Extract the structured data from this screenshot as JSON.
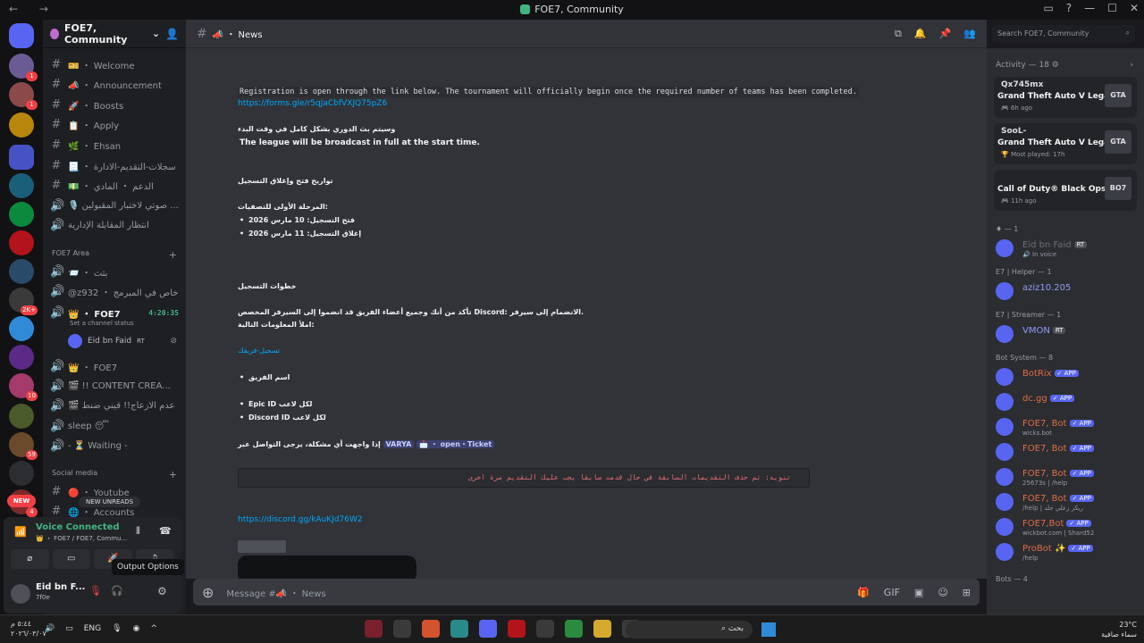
{
  "window": {
    "title": "FOE7, Community",
    "nav": "← →",
    "controls": [
      "▭",
      "?",
      "—",
      "☐",
      "✕"
    ]
  },
  "server": {
    "name": "FOE7, Community"
  },
  "channels": [
    {
      "hash": "#",
      "label": "🎫 ・ Welcome",
      "active": false
    },
    {
      "hash": "#",
      "label": "📣 ・ Announcement",
      "active": false
    },
    {
      "hash": "#",
      "label": "🚀 ・ Boosts",
      "active": false
    },
    {
      "hash": "#",
      "label": "📋 ・ Apply",
      "active": false
    },
    {
      "hash": "#",
      "label": "🌿 ・ Ehsan",
      "active": false
    },
    {
      "hash": "#",
      "label": "📃 ・ سجلات-التقديم-الادارة",
      "active": false
    },
    {
      "hash": "#",
      "label": "💵 ・ الدعم ・ المادي",
      "active": false
    },
    {
      "hash": "🔊",
      "label": "🎙️ صوتي لاختبار المقبولين ...",
      "active": false
    },
    {
      "hash": "🔊",
      "label": "انتظار المقابلة الإدارية",
      "active": false
    }
  ],
  "category_area": {
    "label": "FOE7 Area",
    "plus": "+"
  },
  "area_channels": [
    {
      "hash": "🔊",
      "label": "📨 ・ بثث"
    },
    {
      "hash": "🔊",
      "label": "@z932 ・ خاص في المبرمج"
    },
    {
      "hash": "🔊",
      "label": "👑 ・ FOE7",
      "time": "4:20:35",
      "active": true
    },
    {
      "hash": "🔊",
      "label": "👑 ・ FOE7"
    },
    {
      "hash": "🔊",
      "label": "🎬 !! CONTENT CREA..."
    },
    {
      "hash": "🔊",
      "label": "🎬 عدم الازعاج!! قيني ضنط"
    },
    {
      "hash": "🔊",
      "label": "sleep 😴"
    },
    {
      "hash": "🔊",
      "label": "- ⏳ Waiting -"
    }
  ],
  "channel_status_hint": "Set a channel status",
  "voice_user": "Eid bn Faid",
  "voice_user_tag": "RT",
  "category_social": {
    "label": "Social media",
    "plus": "+"
  },
  "social_channels": [
    {
      "hash": "#",
      "label": "🔴 ・ Youtube"
    },
    {
      "hash": "#",
      "label": "🌐 ・ Accounts"
    }
  ],
  "new_unreads": "NEW UNREADS",
  "voice_panel": {
    "status": "Voice Connected",
    "sub": "👑 ・ FOE7 / FOE7, Commu...",
    "buttons": [
      "⌀",
      "▭",
      "🚀",
      "♫"
    ],
    "user_name": "Eid bn F...",
    "user_tag": "7f0e",
    "tooltip": "Output Options"
  },
  "chat": {
    "channel_name": "📣 ・ News",
    "composer_placeholder": "Message #📣 ・ News",
    "lines": {
      "registration": "Registration is open through the link below. The tournament will officially begin once the required number of teams has been completed.",
      "form_link": "https://forms.gle/r5qJaCbfVXJQ75pZ6",
      "ar_broadcast": "وسيتم بث الدوري بشكل كامل في وقت البدء",
      "en_broadcast": "The league will be broadcast in full at the start time.",
      "ar_dates_title": "تواريخ فتح وإغلاق التسجيل",
      "ar_phase": "المرحلة الأولى للتصفيات:",
      "ar_open": "فتح التسجيل: 10 مارس 2026",
      "ar_close": "إغلاق التسجيل: 11 مارس 2026",
      "ar_steps": "خطوات التسجيل",
      "ar_step1": "تأكد من أنك وجميع أعضاء الفريق قد انضموا إلى السيرفر المخصص Discord: الانضمام إلى سيرفر.",
      "ar_step2": "املأ المعلومات التالية:",
      "ar_team_link": "تسجيل-فريقك",
      "ar_team_name": "اسم الفريق",
      "ar_epic": "Epic ID لكل لاعب",
      "ar_discord": "Discord ID لكل لاعب",
      "ar_contact": "إذا واجهت أي مشكلة، يرجى التواصل عبر",
      "mention1": "VARYA",
      "mention2": "📩 ・ open・Ticket",
      "code_note": "تنويه: تم حذف التقديمات السابقة في حال قدمت سابقا يجب عليك التقديم مرة اخرى",
      "discord_link": "https://discord.gg/kAuKJd76W2"
    }
  },
  "header_icons": [
    "⧉",
    "🔔",
    "📌",
    "👥"
  ],
  "search_placeholder": "Search FOE7, Community",
  "composer_icons": [
    "🎁",
    "GIF",
    "▣",
    "☺",
    "⊞"
  ],
  "members": {
    "activity_header": "Activity — 18 ⚙",
    "activities": [
      {
        "user": "Qx745mx",
        "game": "Grand Theft Auto V Legacy",
        "time": "🎮 6h ago",
        "art": "GTA"
      },
      {
        "user": "SooL-",
        "game": "Grand Theft Auto V Legacy",
        "time": "🏆 Most played: 17h",
        "art": "GTA"
      },
      {
        "user": "",
        "game": "Call of Duty® Black Ops 7",
        "time": "🎮 11h ago",
        "art": "BO7"
      }
    ],
    "groups": [
      {
        "title": "♦ — 1",
        "members": [
          {
            "name": "Eid bn Faid",
            "sub": "🔊 In voice",
            "tag": "RT"
          }
        ]
      },
      {
        "title": "E7 | Helper — 1",
        "members": [
          {
            "name": "aziz10.205",
            "sub": ""
          }
        ]
      },
      {
        "title": "E7 | Streamer — 1",
        "members": [
          {
            "name": "VMON",
            "sub": "",
            "tag": "RT"
          }
        ]
      },
      {
        "title": "Bot System — 8",
        "members": [
          {
            "name": "BotRix",
            "sub": "",
            "app": "✓ APP"
          },
          {
            "name": "dc.gg",
            "sub": "",
            "app": "✓ APP"
          },
          {
            "name": "FOE7, Bot",
            "sub": "wicks.bot",
            "app": "✓ APP"
          },
          {
            "name": "FOE7, Bot",
            "sub": "",
            "app": "✓ APP"
          },
          {
            "name": "FOE7, Bot",
            "sub": "25673s | /help",
            "app": "✓ APP"
          },
          {
            "name": "FOE7, Bot",
            "sub": "/help | ريكر زعلي جلد",
            "app": "✓ APP"
          },
          {
            "name": "FOE7,Bot",
            "sub": "wickbot.com | Shard52",
            "app": "✓ APP"
          },
          {
            "name": "ProBot ✨",
            "sub": "/help",
            "app": "✓ APP"
          }
        ]
      },
      {
        "title": "Bots — 4",
        "members": []
      }
    ]
  },
  "taskbar": {
    "time": "٥:٤٤ م",
    "date": "٢٠٢٦/٠٣/٠٧",
    "lang": "ENG",
    "search": "بحث",
    "weather_temp": "23°C",
    "weather_desc": "سماء صافية"
  },
  "colors": {
    "accent": "#5865f2",
    "voice_green": "#43b581",
    "danger": "#f23f43"
  }
}
